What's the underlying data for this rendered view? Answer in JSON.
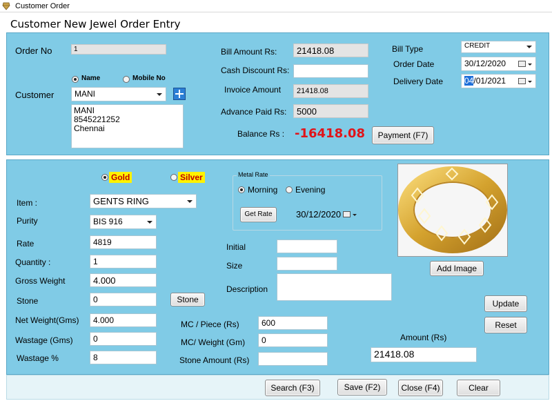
{
  "window": {
    "title": "Customer Order"
  },
  "header": {
    "title": "Customer New Jewel Order Entry"
  },
  "order": {
    "order_no_label": "Order No",
    "order_no_value": "1",
    "customer_label": "Customer",
    "search_by_name_label": "Name",
    "search_by_mobile_label": "Mobile No",
    "customer_value": "MANI",
    "customer_address_lines": [
      "MANI",
      "8545221252",
      "Chennai"
    ]
  },
  "billing": {
    "bill_amount_label": "Bill Amount Rs:",
    "bill_amount_value": "21418.08",
    "cash_discount_label": "Cash Discount Rs:",
    "cash_discount_value": "",
    "invoice_amount_label": "Invoice Amount",
    "invoice_amount_value": "21418.08",
    "advance_paid_label": "Advance Paid Rs:",
    "advance_paid_value": "5000",
    "balance_label": "Balance Rs :",
    "balance_value": "-16418.08",
    "payment_button": "Payment (F7)"
  },
  "bill_info": {
    "bill_type_label": "Bill Type",
    "bill_type_value": "CREDIT",
    "order_date_label": "Order Date",
    "order_date_value": "30/12/2020",
    "delivery_date_label": "Delivery Date",
    "delivery_date_day": "04",
    "delivery_date_rest": "/01/2021"
  },
  "item": {
    "gold_label": "Gold",
    "silver_label": "Silver",
    "item_label": "Item :",
    "item_value": "GENTS RING",
    "purity_label": "Purity",
    "purity_value": "BIS 916",
    "rate_label": "Rate",
    "rate_value": "4819",
    "quantity_label": "Quantity :",
    "quantity_value": "1",
    "gross_weight_label": "Gross Weight",
    "gross_weight_value": "4.000",
    "stone_label": "Stone",
    "stone_value": "0",
    "stone_button": "Stone",
    "net_weight_label": "Net Weight(Gms)",
    "net_weight_value": "4.000",
    "wastage_gms_label": "Wastage (Gms)",
    "wastage_gms_value": "0",
    "wastage_pct_label": "Wastage %",
    "wastage_pct_value": "8"
  },
  "metal_rate": {
    "title": "Metal Rate",
    "morning_label": "Morning",
    "evening_label": "Evening",
    "get_rate_button": "Get Rate",
    "rate_date_value": "30/12/2020"
  },
  "details": {
    "initial_label": "Initial",
    "initial_value": "",
    "size_label": "Size",
    "size_value": "",
    "description_label": "Description",
    "description_value": "",
    "mc_piece_label": "MC / Piece (Rs)",
    "mc_piece_value": "600",
    "mc_weight_label": "MC/ Weight (Gm)",
    "mc_weight_value": "0",
    "stone_amount_label": "Stone Amount (Rs)",
    "stone_amount_value": "",
    "amount_label": "Amount (Rs)",
    "amount_value": "21418.08"
  },
  "image_panel": {
    "add_image_button": "Add Image"
  },
  "actions": {
    "update_button": "Update",
    "reset_button": "Reset",
    "search_button": "Search (F3)",
    "save_button": "Save (F2)",
    "close_button": "Close (F4)",
    "clear_button": "Clear"
  },
  "colors": {
    "panel_bg": "#80cbe6",
    "balance_red": "#e0141a",
    "metal_tag_bg": "#fff200",
    "metal_tag_text": "#c00000"
  },
  "icons": [
    "app-icon",
    "add-customer-plus-icon",
    "dropdown-arrow-icon",
    "calendar-icon",
    "ring-product-image"
  ]
}
